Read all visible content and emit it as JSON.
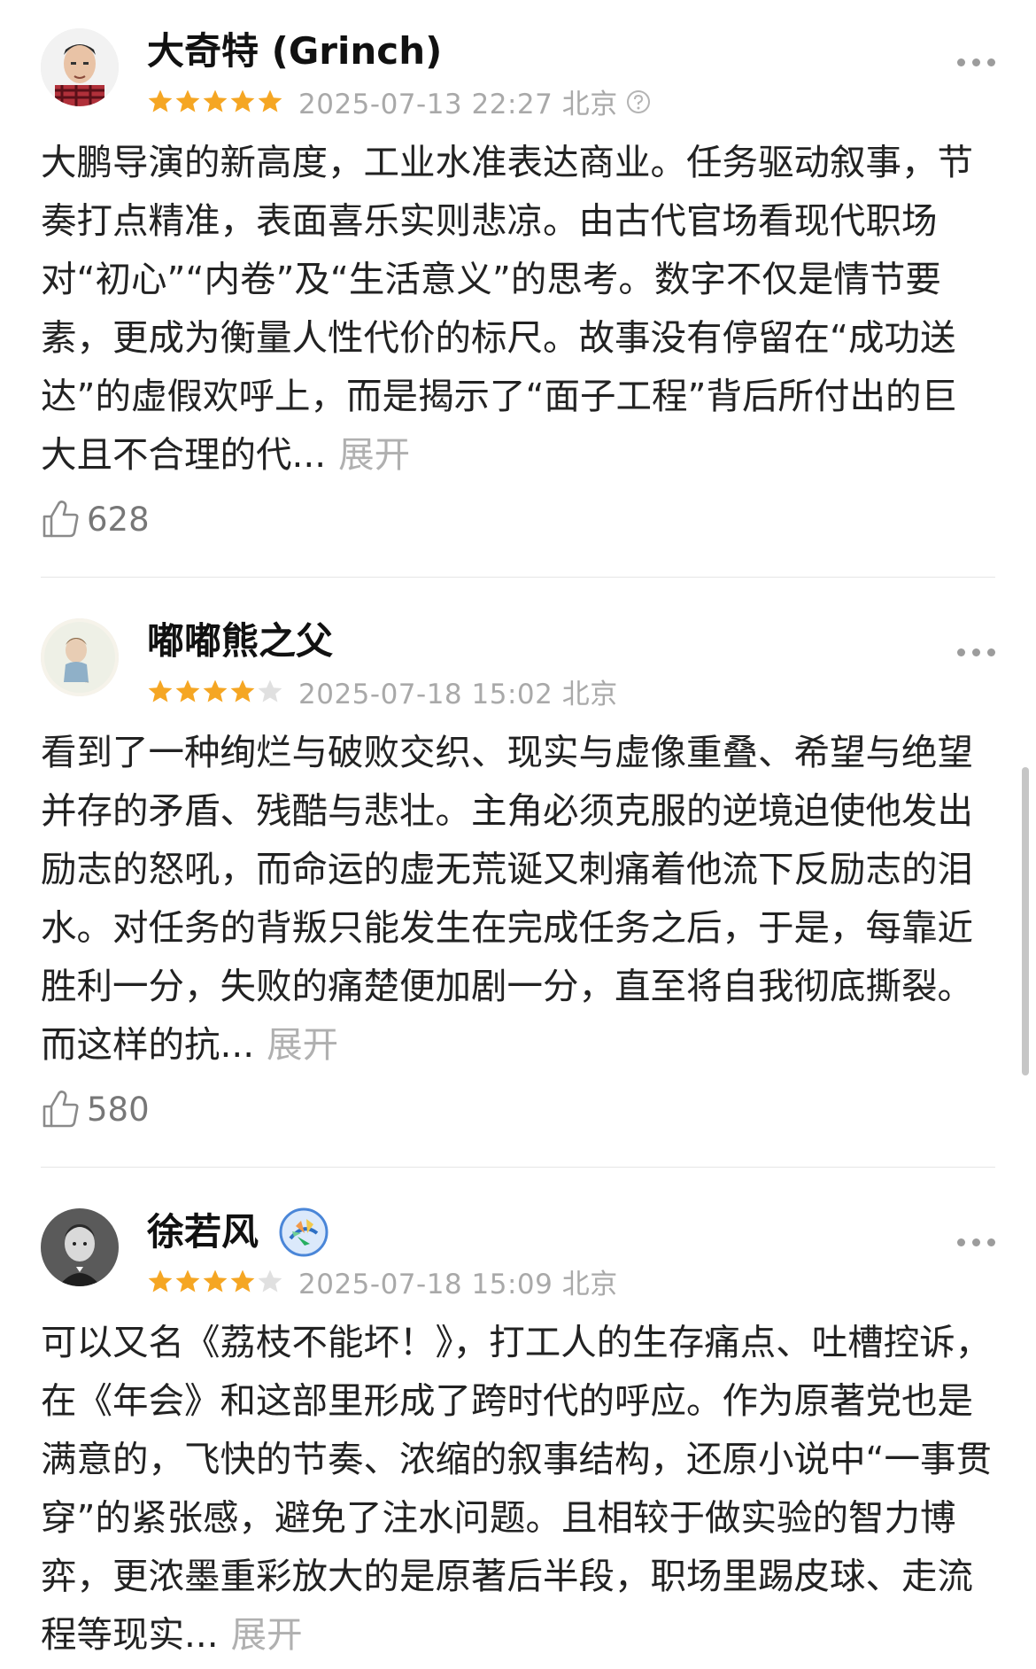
{
  "reviews": [
    {
      "username": "大奇特 (Grinch)",
      "rating": 5,
      "date": "2025-07-13 22:27 北京",
      "has_help_icon": true,
      "has_badge": false,
      "text": "大鹏导演的新高度，工业水准表达商业。任务驱动叙事，节奏打点精准，表面喜乐实则悲凉。由古代官场看现代职场对“初心”“内卷”及“生活意义”的思考。数字不仅是情节要素，更成为衡量人性代价的标尺。故事没有停留在“成功送达”的虚假欢呼上，而是揭示了“面子工程”背后所付出的巨大且不合理的代...",
      "expand_label": "展开",
      "likes": "628"
    },
    {
      "username": "嘟嘟熊之父",
      "rating": 4,
      "date": "2025-07-18 15:02 北京",
      "has_help_icon": false,
      "has_badge": false,
      "text": "看到了一种绚烂与破败交织、现实与虚像重叠、希望与绝望并存的矛盾、残酷与悲壮。主角必须克服的逆境迫使他发出励志的怒吼，而命运的虚无荒诞又刺痛着他流下反励志的泪水。对任务的背叛只能发生在完成任务之后，于是，每靠近胜利一分，失败的痛楚便加剧一分，直至将自我彻底撕裂。而这样的抗...",
      "expand_label": "展开",
      "likes": "580"
    },
    {
      "username": "徐若风",
      "rating": 4,
      "date": "2025-07-18 15:09 北京",
      "has_help_icon": false,
      "has_badge": true,
      "text": "可以又名《荔枝不能坏！》，打工人的生存痛点、吐槽控诉，在《年会》和这部里形成了跨时代的呼应。作为原著党也是满意的，飞快的节奏、浓缩的叙事结构，还原小说中“一事贯穿”的紧张感，避免了注水问题。且相较于做实验的智力博弈，更浓墨重彩放大的是原著后半段，职场里踢皮球、走流程等现实...",
      "expand_label": "展开",
      "likes": ""
    }
  ],
  "colors": {
    "star_on": "#f5a623",
    "star_off": "#e0e0e0",
    "muted_text": "#a9a9a9",
    "body_text": "#222222"
  },
  "icons": [
    "more-icon",
    "thumb-up-icon",
    "help-icon",
    "star-icon",
    "verified-badge-icon"
  ]
}
